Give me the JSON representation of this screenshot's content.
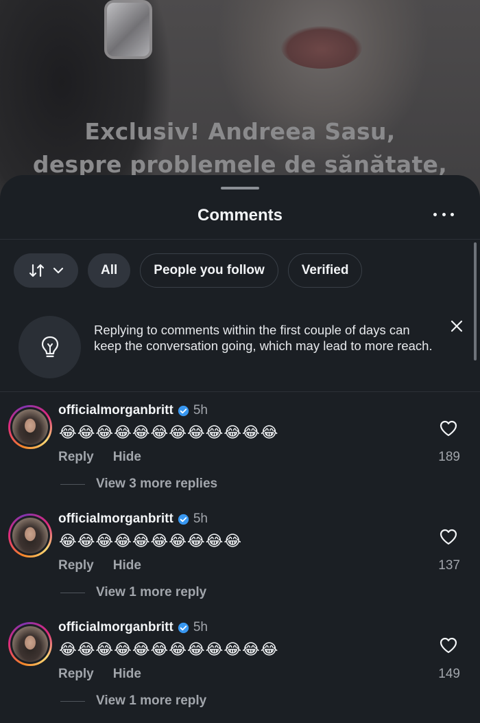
{
  "background": {
    "headline_line1": "Exclusiv! Andreea Sasu,",
    "headline_line2": "despre problemele de sănătate,"
  },
  "sheet": {
    "title": "Comments",
    "more_icon": "more-horizontal-icon"
  },
  "filters": {
    "sort_icon": "sort-arrows-icon",
    "chevron_icon": "chevron-down-icon",
    "chips": [
      "All",
      "People you follow",
      "Verified"
    ]
  },
  "tip": {
    "icon": "lightbulb-icon",
    "text": "Replying to comments within the first couple of days can keep the conversation going, which may lead to more reach.",
    "close_icon": "close-icon"
  },
  "comments": [
    {
      "username": "officialmorganbritt",
      "verified": true,
      "time": "5h",
      "text": "😂😂😂😂😂😂😂😂😂😂😂😂",
      "reply_label": "Reply",
      "hide_label": "Hide",
      "likes": "189",
      "more_replies": "View 3 more replies"
    },
    {
      "username": "officialmorganbritt",
      "verified": true,
      "time": "5h",
      "text": "😂😂😂😂😂😂😂😂😂😂",
      "reply_label": "Reply",
      "hide_label": "Hide",
      "likes": "137",
      "more_replies": "View 1 more reply"
    },
    {
      "username": "officialmorganbritt",
      "verified": true,
      "time": "5h",
      "text": "😂😂😂😂😂😂😂😂😂😂😂😂",
      "reply_label": "Reply",
      "hide_label": "Hide",
      "likes": "149",
      "more_replies": "View 1 more reply"
    }
  ],
  "colors": {
    "sheet_bg": "#1b1f24",
    "verified_blue": "#3897f0",
    "secondary_text": "#a2a6ac"
  }
}
